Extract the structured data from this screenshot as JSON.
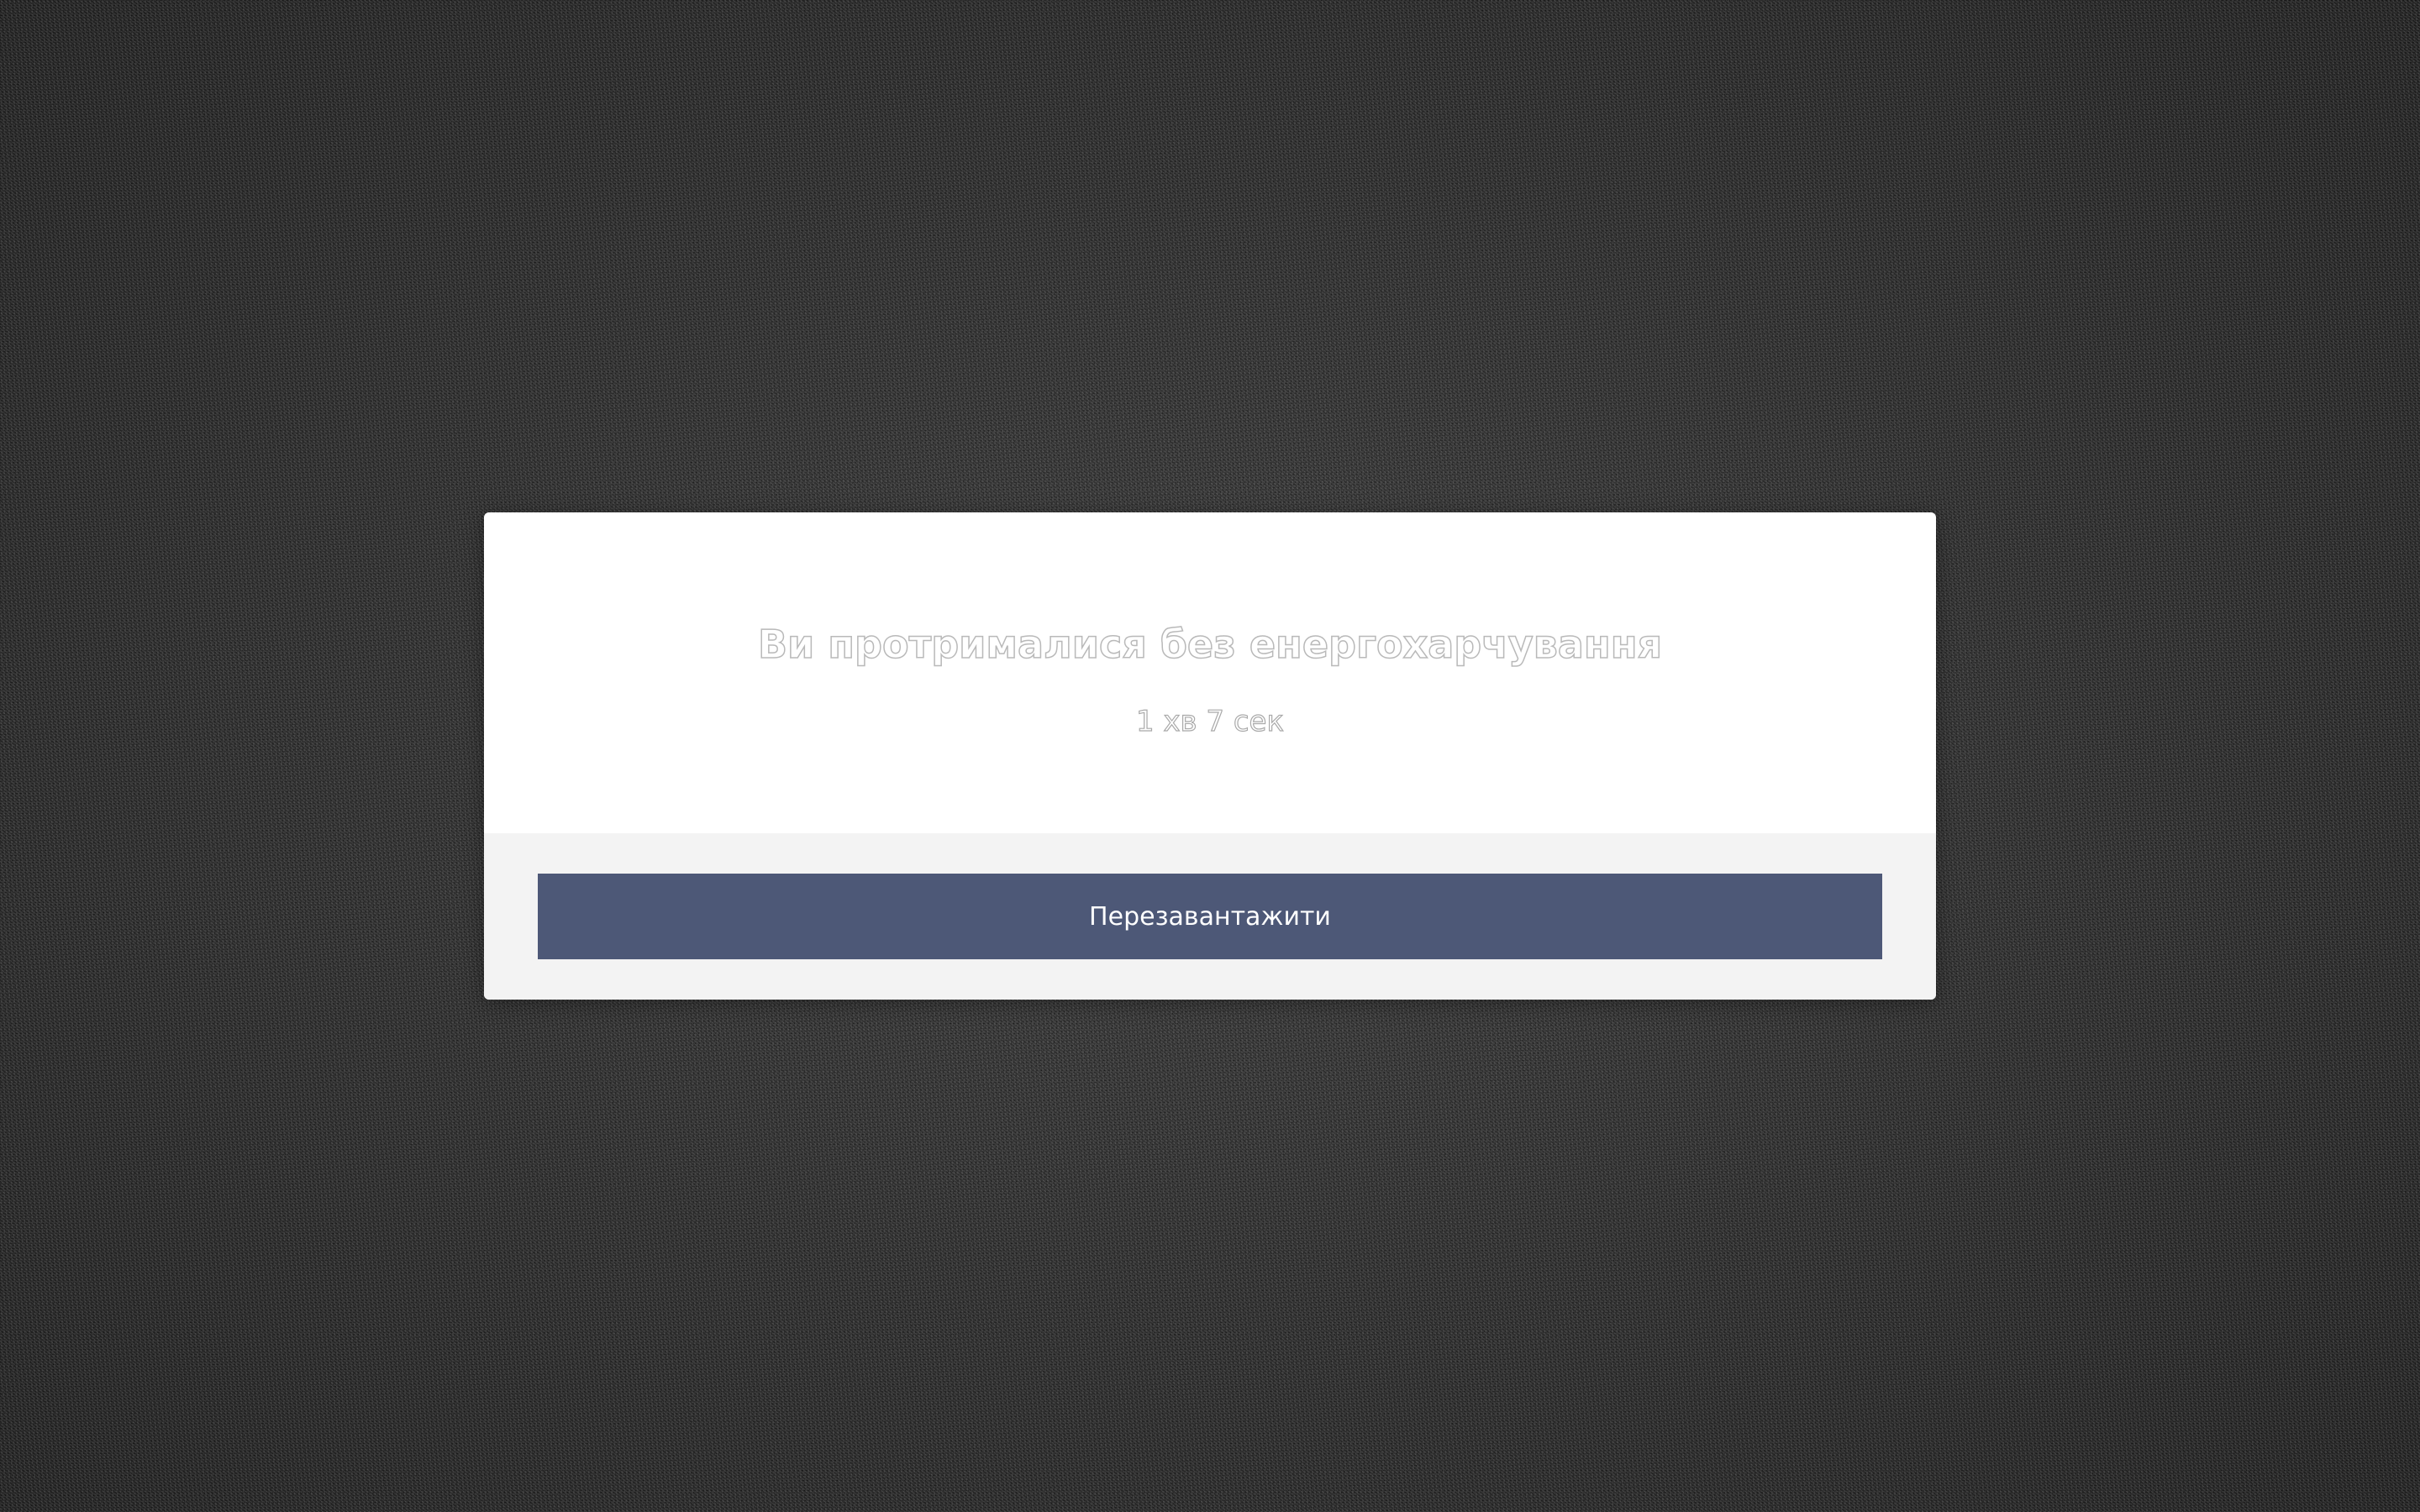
{
  "dialog": {
    "title": "Ви протрималися без енергохарчування",
    "time": "1 хв 7 сек",
    "reload_label": "Перезавантажити"
  },
  "colors": {
    "button": "#4d5877",
    "footer": "#f3f3f3",
    "background": "#2c2c2c"
  }
}
